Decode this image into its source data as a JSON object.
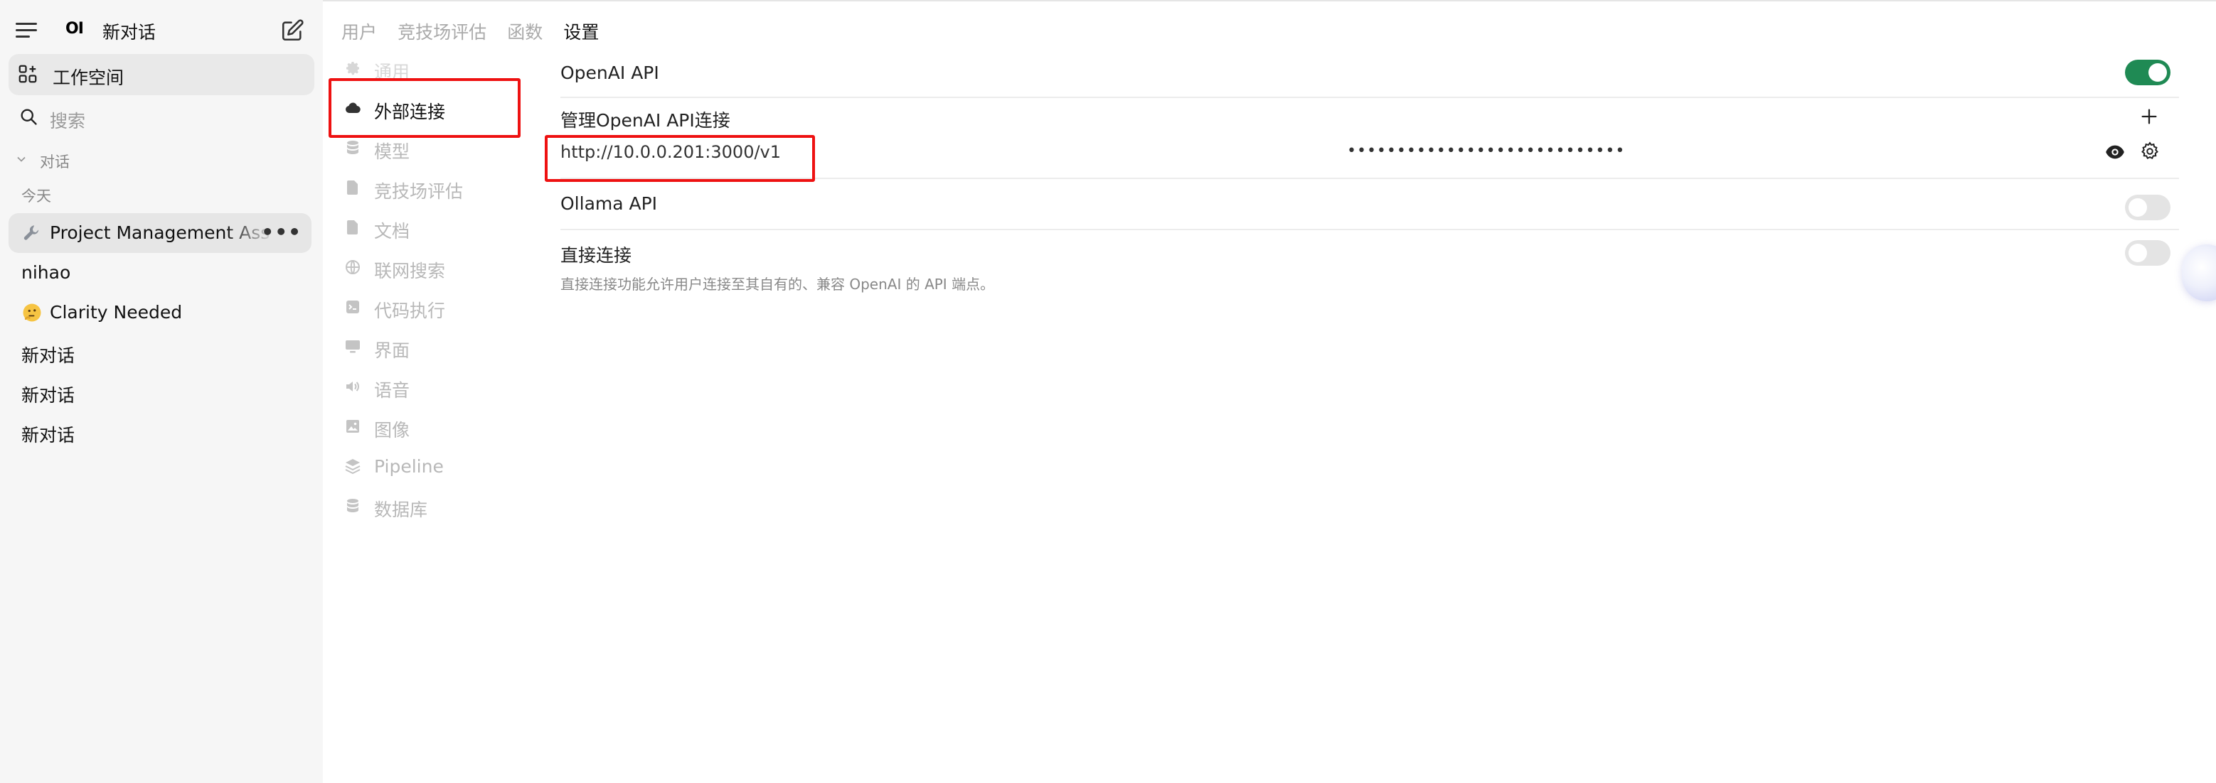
{
  "sidebar": {
    "title": "新对话",
    "logo": "OI",
    "workspace_label": "工作空间",
    "search_placeholder": "搜索",
    "folder_label": "对话",
    "date_group": "今天",
    "chats": [
      {
        "title": "Project Management Ass",
        "emoji": "wrench-icon",
        "active": true
      },
      {
        "title": "nihao",
        "emoji": null
      },
      {
        "title": "Clarity Needed",
        "emoji": "thinking-face-icon"
      },
      {
        "title": "新对话",
        "emoji": null
      },
      {
        "title": "新对话",
        "emoji": null
      },
      {
        "title": "新对话",
        "emoji": null
      }
    ],
    "more_glyph": "•••"
  },
  "tabs": [
    {
      "label": "用户",
      "active": false
    },
    {
      "label": "竞技场评估",
      "active": false
    },
    {
      "label": "函数",
      "active": false
    },
    {
      "label": "设置",
      "active": true
    }
  ],
  "settings_nav": [
    {
      "label": "通用",
      "icon": "gear-icon"
    },
    {
      "label": "外部连接",
      "icon": "cloud-icon",
      "active": true
    },
    {
      "label": "模型",
      "icon": "database-icon"
    },
    {
      "label": "竞技场评估",
      "icon": "document-icon"
    },
    {
      "label": "文档",
      "icon": "document-icon"
    },
    {
      "label": "联网搜索",
      "icon": "globe-icon"
    },
    {
      "label": "代码执行",
      "icon": "terminal-icon"
    },
    {
      "label": "界面",
      "icon": "monitor-icon"
    },
    {
      "label": "语音",
      "icon": "speaker-icon"
    },
    {
      "label": "图像",
      "icon": "image-icon"
    },
    {
      "label": "Pipeline",
      "icon": "layers-icon"
    },
    {
      "label": "数据库",
      "icon": "database-icon"
    }
  ],
  "connections": {
    "openai_label": "OpenAI API",
    "openai_enabled": true,
    "manage_label": "管理OpenAI API连接",
    "url": "http://10.0.0.201:3000/v1",
    "api_key_masked": "••••••••••••••••••••••••••••",
    "ollama_label": "Ollama API",
    "ollama_enabled": false,
    "direct_label": "直接连接",
    "direct_enabled": false,
    "direct_desc": "直接连接功能允许用户连接至其自有的、兼容 OpenAI 的 API 端点。"
  },
  "colors": {
    "accent_green": "#1f8a54",
    "highlight_red": "#ee1111",
    "sidebar_bg": "#f6f6f6"
  }
}
